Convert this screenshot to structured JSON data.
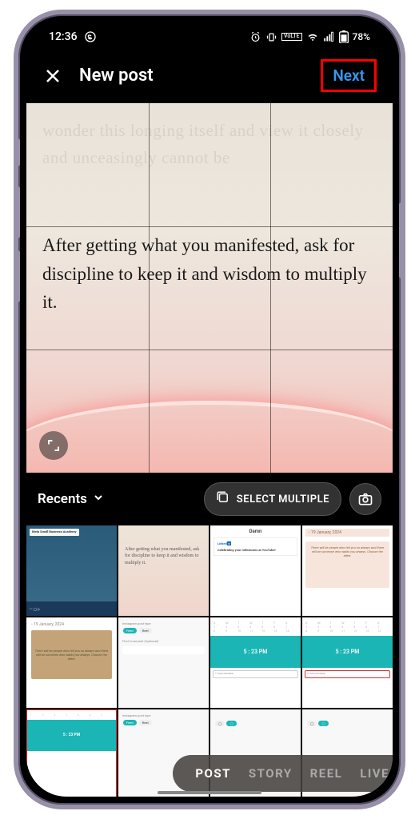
{
  "status": {
    "time": "12:36",
    "battery_pct": "78%"
  },
  "header": {
    "title": "New post",
    "next_label": "Next"
  },
  "preview": {
    "quote": "After getting what you manifested, ask for discipline to keep it and wisdom to multiply it.",
    "bg_faint_lines": "wonder this longing itself and view it closely and unceasingly cannot be"
  },
  "gallery": {
    "album_label": "Recents",
    "select_multiple_label": "SELECT MULTIPLE"
  },
  "thumbs": {
    "meta_line1": "Meta Small Business Academy",
    "quote_line": "After getting what you manifested, ask for discipline to keep it and wisdom to multiply it.",
    "damn": "Damn",
    "milestones": "Celebrating your milestones at YouTube!",
    "date": "19 January, 2024",
    "brown_text": "There will be people who tell you no always and there will be someone who walks you always. Choose the latter.",
    "post_type": "Instagram post type",
    "comment": "First Comment (Optional)",
    "cal_time": "5 : 23  PM",
    "chip_f": "Feed",
    "chip_r": "Reel"
  },
  "modes": {
    "post": "POST",
    "story": "STORY",
    "reel": "REEL",
    "live": "LIVE"
  }
}
